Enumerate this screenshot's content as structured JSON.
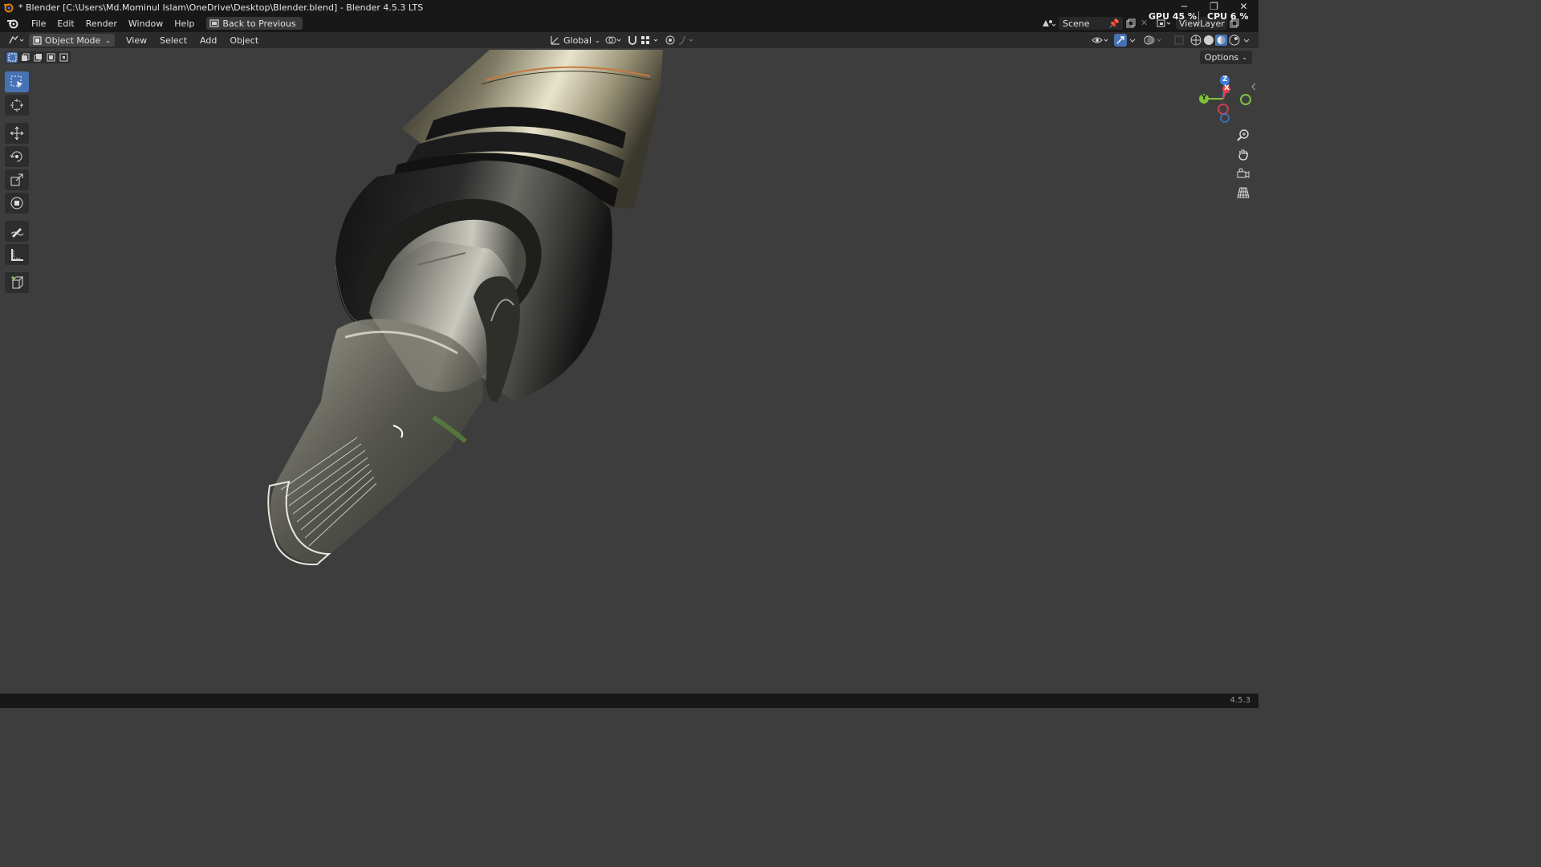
{
  "window": {
    "title": "* Blender [C:\\Users\\Md.Mominul Islam\\OneDrive\\Desktop\\Blender.blend] - Blender 4.5.3 LTS",
    "controls": [
      "─",
      "❐",
      "✕"
    ]
  },
  "menubar": {
    "items": [
      "File",
      "Edit",
      "Render",
      "Window",
      "Help"
    ],
    "back_button": "Back to Previous",
    "scene": "Scene",
    "view_layer": "ViewLayer",
    "gpu_label": "GPU",
    "gpu_value": "45 %",
    "cpu_label": "CPU",
    "cpu_value": "6 %"
  },
  "header3d": {
    "mode": "Object Mode",
    "menus": [
      "View",
      "Select",
      "Add",
      "Object"
    ],
    "transform_orientation": "Global"
  },
  "viewport": {
    "options_label": "Options",
    "gizmo_axes": [
      "Z",
      "X",
      "Y"
    ]
  },
  "toolbar": {
    "tools": [
      "select-box",
      "cursor",
      "move",
      "rotate",
      "scale",
      "transform",
      "annotate",
      "measure",
      "add-cube"
    ]
  },
  "statusbar": {
    "version": "4.5.3"
  },
  "colors": {
    "accent": "#4772b3",
    "axis_x": "#e8404f",
    "axis_y": "#7fc23a",
    "axis_z": "#3b7fe0"
  }
}
